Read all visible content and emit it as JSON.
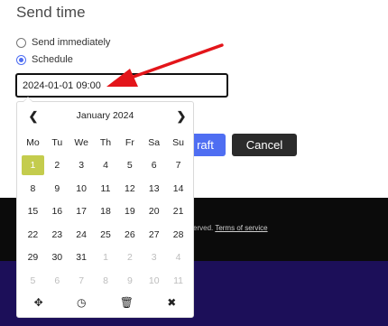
{
  "section": {
    "title": "Send time"
  },
  "options": {
    "immediate": "Send immediately",
    "schedule": "Schedule"
  },
  "input": {
    "value": "2024-01-01 09:00"
  },
  "buttons": {
    "draft": "raft",
    "cancel": "Cancel"
  },
  "footer": {
    "text": "erved.",
    "link": "Terms of service"
  },
  "calendar": {
    "title": "January 2024",
    "dows": [
      "Mo",
      "Tu",
      "We",
      "Th",
      "Fr",
      "Sa",
      "Su"
    ],
    "weeks": [
      [
        "1",
        "2",
        "3",
        "4",
        "5",
        "6",
        "7"
      ],
      [
        "8",
        "9",
        "10",
        "11",
        "12",
        "13",
        "14"
      ],
      [
        "15",
        "16",
        "17",
        "18",
        "19",
        "20",
        "21"
      ],
      [
        "22",
        "23",
        "24",
        "25",
        "26",
        "27",
        "28"
      ],
      [
        "29",
        "30",
        "31",
        "1",
        "2",
        "3",
        "4"
      ],
      [
        "5",
        "6",
        "7",
        "8",
        "9",
        "10",
        "11"
      ]
    ],
    "selected": "1",
    "icons": {
      "prev": "chevron-left-icon",
      "next": "chevron-right-icon",
      "move": "move-icon",
      "clock": "clock-icon",
      "trash": "trash-icon",
      "close": "close-icon"
    }
  },
  "colors": {
    "accent": "#4f6ef2",
    "selected_day": "#c4cc4d",
    "annotation_arrow": "#e3151a"
  }
}
